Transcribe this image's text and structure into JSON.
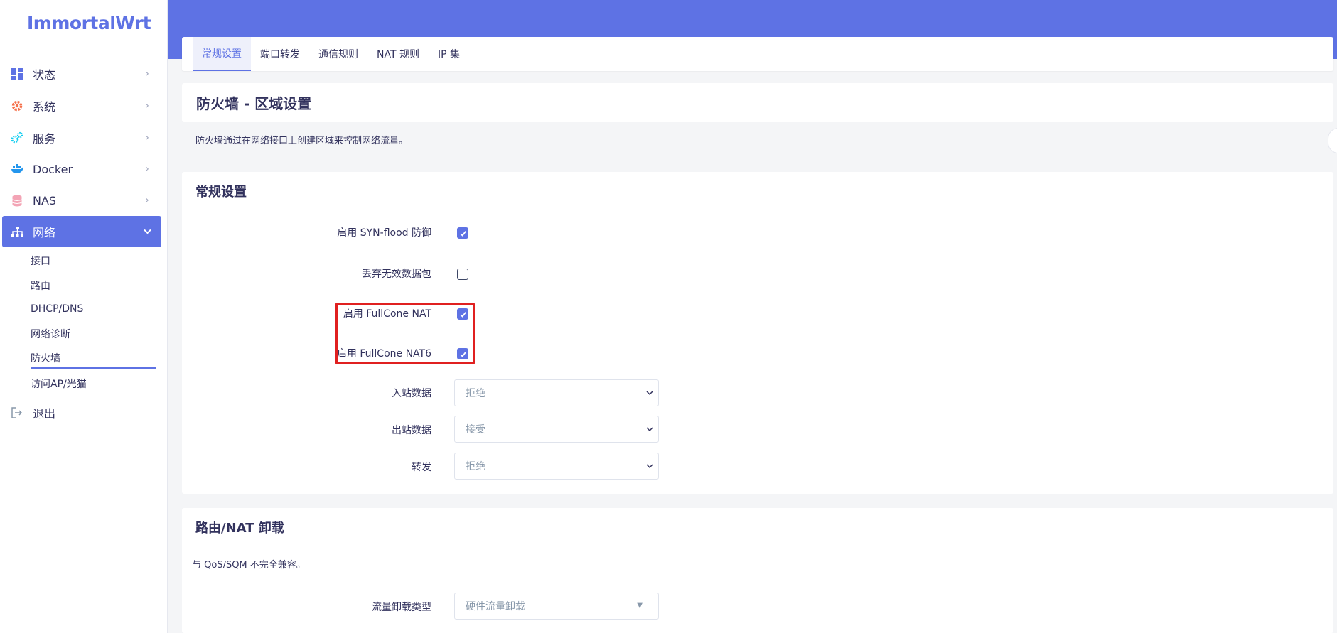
{
  "brand": {
    "logo": "ImmortalWrt",
    "accent": "#5e72e4",
    "highlight": "#e02020"
  },
  "sidebar": {
    "items": [
      {
        "label": "状态",
        "icon": "dashboard-icon",
        "active": false
      },
      {
        "label": "系统",
        "icon": "gear-icon",
        "active": false
      },
      {
        "label": "服务",
        "icon": "gears-icon",
        "active": false
      },
      {
        "label": "Docker",
        "icon": "docker-whale-icon",
        "active": false
      },
      {
        "label": "NAS",
        "icon": "database-icon",
        "active": false
      },
      {
        "label": "网络",
        "icon": "sitemap-icon",
        "active": true
      }
    ],
    "subitems": [
      {
        "label": "接口"
      },
      {
        "label": "路由"
      },
      {
        "label": "DHCP/DNS"
      },
      {
        "label": "网络诊断"
      },
      {
        "label": "防火墙",
        "current": true
      },
      {
        "label": "访问AP/光猫"
      }
    ],
    "logout": {
      "label": "退出",
      "icon": "logout-icon"
    }
  },
  "tabs": [
    {
      "label": "常规设置",
      "active": true
    },
    {
      "label": "端口转发"
    },
    {
      "label": "通信规则"
    },
    {
      "label": "NAT 规则"
    },
    {
      "label": "IP 集"
    }
  ],
  "page": {
    "title": "防火墙 - 区域设置",
    "description": "防火墙通过在网络接口上创建区域来控制网络流量。"
  },
  "general": {
    "title": "常规设置",
    "syn_flood": {
      "label": "启用 SYN-flood 防御",
      "checked": true
    },
    "drop_invalid": {
      "label": "丢弃无效数据包",
      "checked": false
    },
    "fullcone_nat": {
      "label": "启用 FullCone NAT",
      "checked": true
    },
    "fullcone_nat6": {
      "label": "启用 FullCone NAT6",
      "checked": true
    },
    "input": {
      "label": "入站数据",
      "value": "拒绝"
    },
    "output": {
      "label": "出站数据",
      "value": "接受"
    },
    "forward": {
      "label": "转发",
      "value": "拒绝"
    }
  },
  "offload": {
    "title": "路由/NAT 卸载",
    "description": "与 QoS/SQM 不完全兼容。",
    "type": {
      "label": "流量卸载类型",
      "value": "硬件流量卸载"
    }
  }
}
